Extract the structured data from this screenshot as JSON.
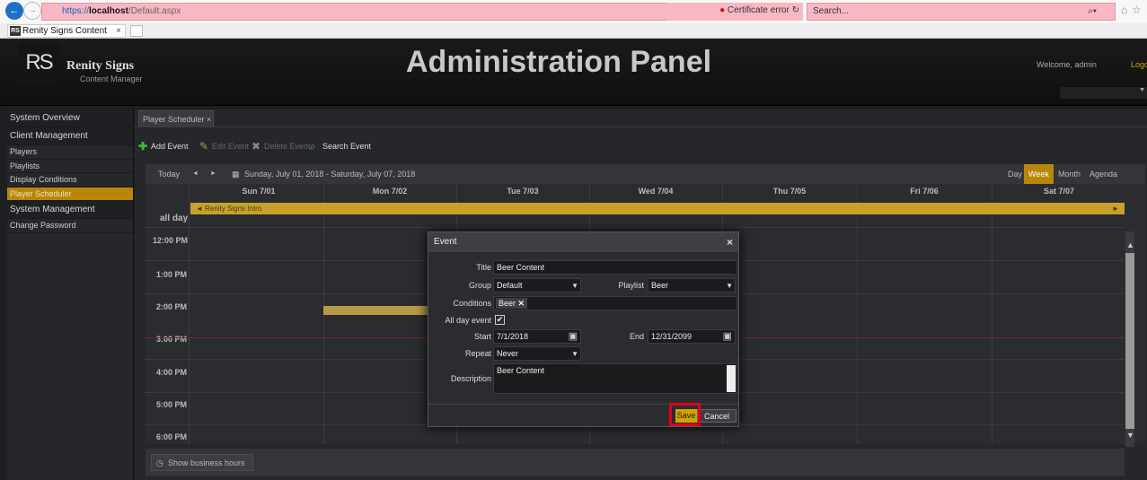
{
  "browser": {
    "address_protocol": "https://",
    "address_host": "localhost",
    "address_path": "/Default.aspx",
    "cert_error": "Certificate error",
    "search_placeholder": "Search...",
    "tab_title": "Renity Signs Content Mana",
    "tab_icon_text": "RS"
  },
  "header": {
    "logo_text": "RS",
    "brand_name": "Renity Signs",
    "brand_sub": "Content Manager",
    "title": "Administration Panel",
    "welcome": "Welcome, admin",
    "logout": "Logo"
  },
  "sidebar": {
    "items": [
      {
        "label": "System Overview",
        "type": "section"
      },
      {
        "label": "Client Management",
        "type": "section"
      },
      {
        "label": "Players",
        "type": "item"
      },
      {
        "label": "Playlists",
        "type": "item"
      },
      {
        "label": "Display Conditions",
        "type": "item"
      },
      {
        "label": "Player Scheduler",
        "type": "active"
      },
      {
        "label": "System Management",
        "type": "section"
      },
      {
        "label": "Change Password",
        "type": "item"
      }
    ]
  },
  "main": {
    "tab_label": "Player Scheduler ×",
    "toolbar": {
      "add": "Add Event",
      "edit": "Edit Event",
      "delete": "Delete Event",
      "search": "Search Event"
    },
    "calendar": {
      "today": "Today",
      "prev": "◄",
      "next": "►",
      "range": "Sunday, July 01, 2018 - Saturday, July 07, 2018",
      "views": [
        "Day",
        "Week",
        "Month",
        "Agenda"
      ],
      "active_view": "Week",
      "days": [
        "Sun 7/01",
        "Mon 7/02",
        "Tue 7/03",
        "Wed 7/04",
        "Thu 7/05",
        "Fri 7/06",
        "Sat 7/07"
      ],
      "all_day_label": "all day",
      "all_day_event": "◄ Renity Signs Intro",
      "all_day_event_end": "►",
      "hours": [
        "12:00 PM",
        "1:00 PM",
        "2:00 PM",
        "3:00 PM",
        "4:00 PM",
        "5:00 PM",
        "6:00 PM"
      ],
      "show_business_hours": "Show business hours"
    }
  },
  "dialog": {
    "title": "Event",
    "close": "×",
    "labels": {
      "title": "Title",
      "group": "Group",
      "playlist": "Playlist",
      "conditions": "Conditions",
      "all_day": "All day event",
      "start": "Start",
      "end": "End",
      "repeat": "Repeat",
      "description": "Description"
    },
    "values": {
      "title": "Beer Content",
      "group": "Default",
      "playlist": "Beer",
      "condition_tag": "Beer",
      "condition_remove": "✕",
      "all_day_checked": "✔",
      "start": "7/1/2018",
      "end": "12/31/2099",
      "repeat": "Never",
      "description": "Beer Content"
    },
    "save": "Save",
    "cancel": "Cancel"
  },
  "colors": {
    "accent": "#b8860b",
    "address_bar_error": "#f9b7c3",
    "highlight": "#e2001a"
  }
}
